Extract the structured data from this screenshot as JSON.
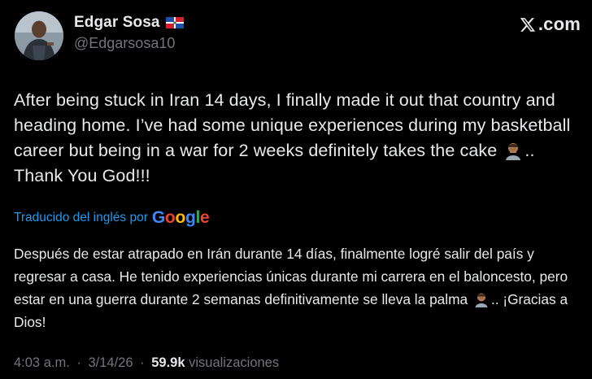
{
  "author": {
    "display_name": "Edgar Sosa",
    "handle": "@Edgarsosa10",
    "flag_icon": "dominican-republic-flag"
  },
  "brand": {
    "label": ".com",
    "icon": "x-logo-icon"
  },
  "tweet": {
    "text_before_emoji": "After being stuck in Iran 14 days, I finally made it out that country and heading home. I’ve had some unique experiences during my basketball career but being in a war for 2 weeks definitely takes the cake",
    "emoji": "man-facepalming-emoji",
    "text_after_emoji": ".. Thank You God!!!"
  },
  "translation": {
    "label": "Traducido del inglés por",
    "provider": "Google",
    "text_before_emoji": "Después de estar atrapado en Irán durante 14 días, finalmente logré salir del país y regresar a casa. He tenido experiencias únicas durante mi carrera en el baloncesto, pero estar en una guerra durante 2 semanas definitivamente se lleva la palma",
    "text_after_emoji": ".. ¡Gracias a Dios!"
  },
  "meta": {
    "time": "4:03 a.m.",
    "separator": "·",
    "date": "3/14/26",
    "views_count": "59.9k",
    "views_label": "visualizaciones"
  },
  "colors": {
    "background": "#000000",
    "text": "#e7e9ea",
    "muted": "#71767b",
    "link": "#1d9bf0"
  }
}
